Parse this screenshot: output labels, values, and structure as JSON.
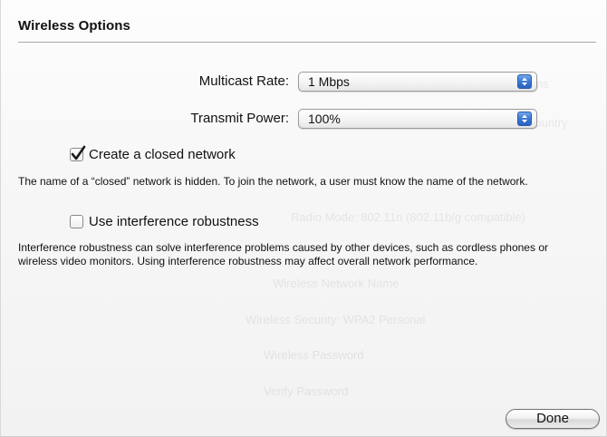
{
  "sheet": {
    "title": "Wireless Options"
  },
  "multicast_rate": {
    "label": "Multicast Rate:",
    "value": "1 Mbps"
  },
  "transmit_power": {
    "label": "Transmit Power:",
    "value": "100%"
  },
  "closed_network": {
    "label": "Create a closed network",
    "checked": true,
    "help": "The name of a “closed” network is hidden. To join the network, a user must know the name of the network."
  },
  "interference_robustness": {
    "label": "Use interference robustness",
    "checked": false,
    "help": "Interference robustness can solve interference problems caused by other devices, such as cordless phones or wireless video monitors. Using interference robustness may affect overall network performance."
  },
  "buttons": {
    "done": "Done"
  },
  "colors": {
    "accent": "#3b78d6"
  }
}
